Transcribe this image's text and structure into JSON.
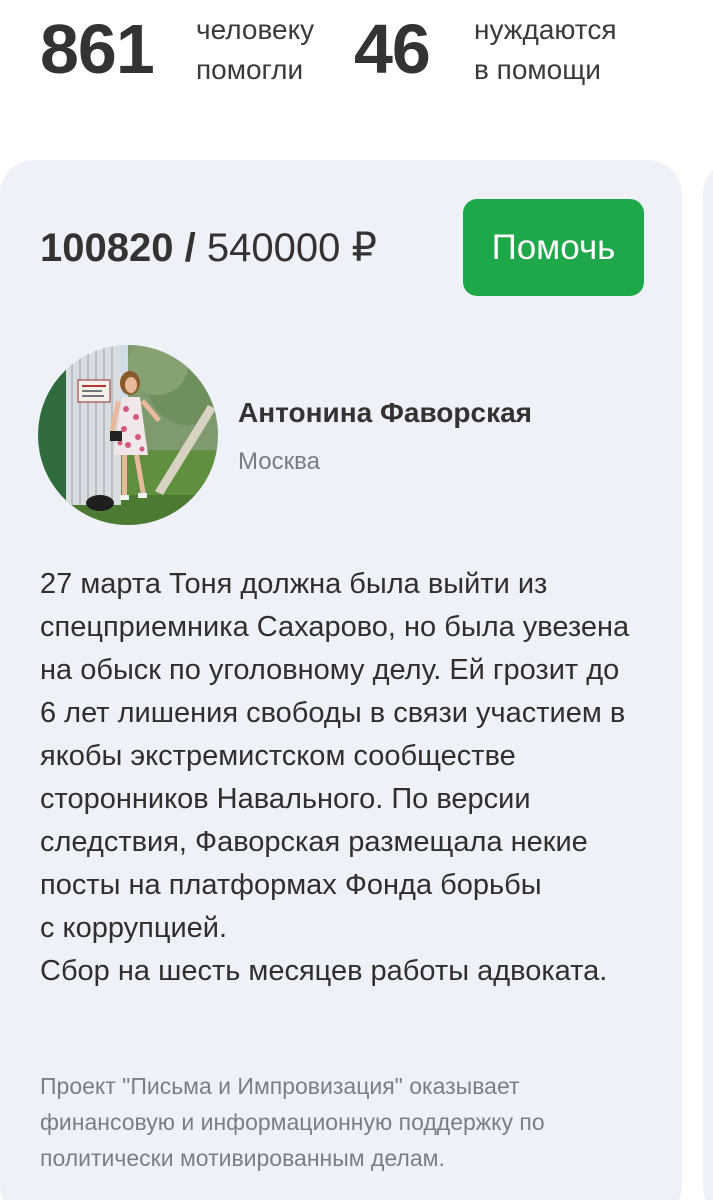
{
  "stats": [
    {
      "value": "861",
      "label_line1": "человеку",
      "label_line2": "помогли"
    },
    {
      "value": "46",
      "label_line1": "нуждаются",
      "label_line2": "в помощи"
    }
  ],
  "case": {
    "collected": "100820",
    "separator": "/",
    "goal": "540000 ₽",
    "help_button": "Помочь",
    "person": {
      "name": "Антонина Фаворская",
      "city": "Москва"
    },
    "description_lines": [
      "27 марта Тоня должна была выйти из",
      "спецприемника Сахарово, но была увезена",
      "на обыск по уголовному делу. Ей грозит до",
      "6 лет лишения свободы в связи участием в",
      "якобы экстремистском сообществе",
      "сторонников Навального. По версии",
      "следствия, Фаворская размещала некие",
      "посты на платформах Фонда борьбы",
      "с коррупцией.",
      "Сбор на шесть месяцев работы адвоката."
    ],
    "footer_lines": [
      "Проект \"Письма и Импровизация\" оказывает",
      "финансовую и информационную поддержку по",
      "политически мотивированным делам."
    ]
  },
  "colors": {
    "accent_green": "#1ea84a",
    "card_background": "#eef2f8",
    "muted_text": "#7a7f87"
  },
  "icons": {
    "avatar": "person-photo"
  }
}
